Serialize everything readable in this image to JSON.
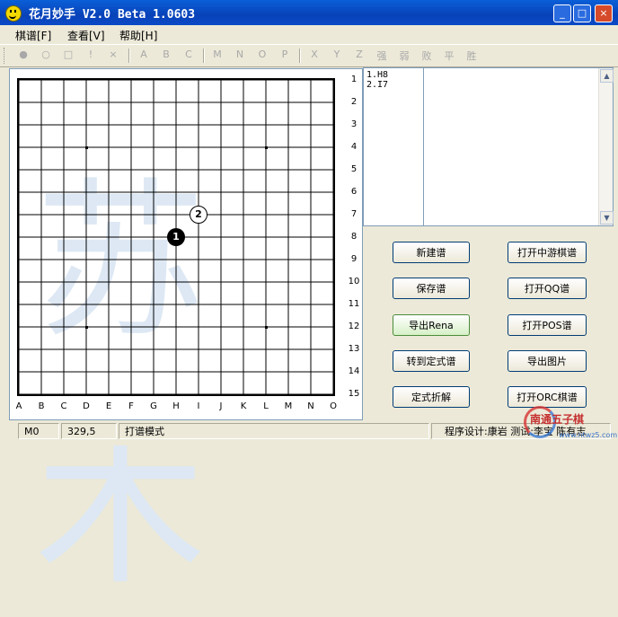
{
  "title": "花月妙手 V2.0 Beta 1.0603",
  "window_controls": {
    "minimize": "_",
    "maximize": "□",
    "close": "×"
  },
  "menu": [
    "棋谱[F]",
    "查看[V]",
    "帮助[H]"
  ],
  "toolbar": [
    "●",
    "○",
    "□",
    "!",
    "×",
    "A",
    "B",
    "C",
    "M",
    "N",
    "O",
    "P",
    "X",
    "Y",
    "Z",
    "强",
    "弱",
    "败",
    "平",
    "胜"
  ],
  "board": {
    "row_labels": [
      "1",
      "2",
      "3",
      "4",
      "5",
      "6",
      "7",
      "8",
      "9",
      "10",
      "11",
      "12",
      "13",
      "14",
      "15"
    ],
    "col_labels": [
      "A",
      "B",
      "C",
      "D",
      "E",
      "F",
      "G",
      "H",
      "I",
      "J",
      "K",
      "L",
      "M",
      "N",
      "O"
    ],
    "watermark": "苏木",
    "stones": [
      {
        "number": "1",
        "color": "black",
        "coord": "H8"
      },
      {
        "number": "2",
        "color": "white",
        "coord": "I7"
      }
    ]
  },
  "moves": [
    "1.H8",
    "2.I7"
  ],
  "buttons": {
    "new": "新建谱",
    "open_zhongyou": "打开中游棋谱",
    "save": "保存谱",
    "open_qq": "打开QQ谱",
    "export_rena": "导出Rena",
    "open_pos": "打开POS谱",
    "to_opening": "转到定式谱",
    "export_image": "导出图片",
    "opening_analysis": "定式折解",
    "open_orc": "打开ORC棋谱"
  },
  "status": {
    "move_code": "M0",
    "coords": "329,5",
    "mode": "打谱模式",
    "credits": "程序设计:康岩 测试:李宝 陈有志"
  },
  "brand": {
    "name": "南通五子棋",
    "url": "www.ntwz5.com"
  },
  "colors": {
    "titlebar": "#0a49c6",
    "window": "#ece9d8",
    "brand_red": "#c53030",
    "brand_blue": "#3a73c7"
  }
}
